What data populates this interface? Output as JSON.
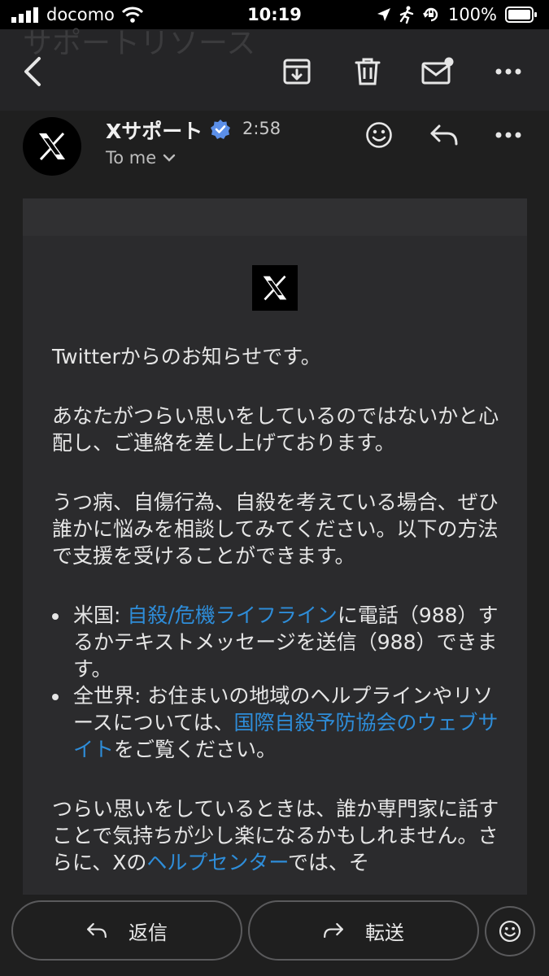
{
  "status_bar": {
    "carrier": "docomo",
    "time": "10:19",
    "battery": "100%",
    "icons": [
      "signal-icon",
      "wifi-icon",
      "location-icon",
      "activity-icon",
      "orientation-lock-icon",
      "battery-icon"
    ]
  },
  "toolbar": {
    "ghost_subject": "サポートリソース",
    "icons": [
      "back-icon",
      "archive-icon",
      "trash-icon",
      "mark-unread-icon",
      "more-icon"
    ]
  },
  "email": {
    "sender_name": "Xサポート",
    "sent_time": "2:58",
    "recipient": "To me",
    "icons": [
      "emoji-reaction-icon",
      "reply-icon",
      "more-icon"
    ],
    "body": {
      "intro": "Twitterからのお知らせです。",
      "paragraph1": "あなたがつらい思いをしているのではないかと心配し、ご連絡を差し上げております。",
      "paragraph2": "うつ病、自傷行為、自殺を考えている場合、ぜひ誰かに悩みを相談してみてください。以下の方法で支援を受けることができます。",
      "bullet1": {
        "prefix": "米国: ",
        "link": "自殺/危機ライフライン",
        "suffix": "に電話（988）するかテキストメッセージを送信（988）できます。"
      },
      "bullet2": {
        "prefix": "全世界: お住まいの地域のヘルプラインやリソースについては、",
        "link": "国際自殺予防協会のウェブサイト",
        "suffix": "をご覧ください。"
      },
      "paragraph3": {
        "text": "つらい思いをしているときは、誰か専門家に話すことで気持ちが少し楽になるかもしれません。さらに、Xの",
        "link": "ヘルプセンター",
        "suffix": "では、そ"
      }
    }
  },
  "bottom_bar": {
    "reply_label": "返信",
    "forward_label": "転送"
  },
  "colors": {
    "background": "#1f1f1f",
    "toolbar": "#252527",
    "card": "#2b2b2d",
    "link": "#2e8dd9",
    "verified": "#5b8fe8"
  }
}
